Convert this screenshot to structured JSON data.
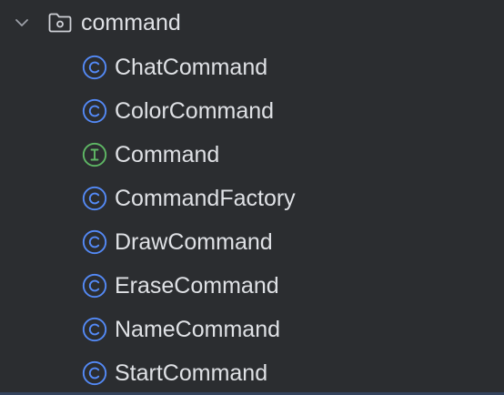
{
  "folder": {
    "name": "command",
    "expanded": true,
    "chevron_icon": "chevron-down-icon",
    "folder_icon": "package-folder-icon"
  },
  "colors": {
    "background": "#2b2d30",
    "text": "#dfe1e5",
    "class_icon": "#548af7",
    "interface_icon": "#5fb865",
    "chevron": "#9da0a8",
    "folder_outline": "#ced0d6"
  },
  "items": [
    {
      "label": "ChatCommand",
      "kind": "class",
      "icon": "class-icon",
      "letter": "C"
    },
    {
      "label": "ColorCommand",
      "kind": "class",
      "icon": "class-icon",
      "letter": "C"
    },
    {
      "label": "Command",
      "kind": "interface",
      "icon": "interface-icon",
      "letter": "I"
    },
    {
      "label": "CommandFactory",
      "kind": "class",
      "icon": "class-icon",
      "letter": "C"
    },
    {
      "label": "DrawCommand",
      "kind": "class",
      "icon": "class-icon",
      "letter": "C"
    },
    {
      "label": "EraseCommand",
      "kind": "class",
      "icon": "class-icon",
      "letter": "C"
    },
    {
      "label": "NameCommand",
      "kind": "class",
      "icon": "class-icon",
      "letter": "C"
    },
    {
      "label": "StartCommand",
      "kind": "class",
      "icon": "class-icon",
      "letter": "C"
    }
  ]
}
